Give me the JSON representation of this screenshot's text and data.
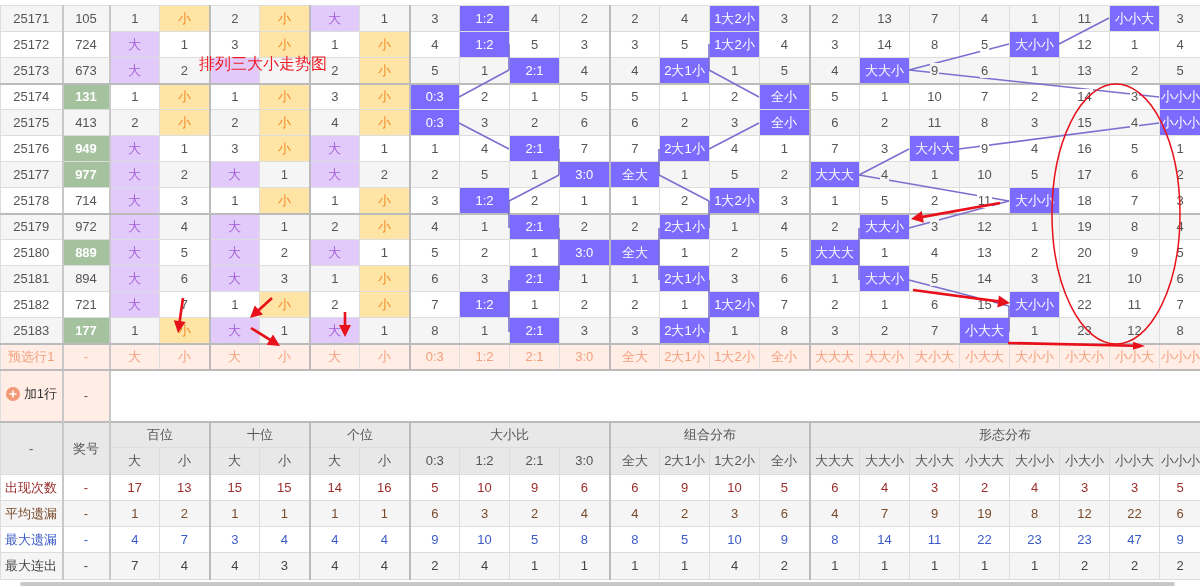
{
  "annotation_title": "排列三大小走势图",
  "header": {
    "corner": "-",
    "number_label": "奖号"
  },
  "groups": [
    {
      "label": "百位",
      "kind": "digit",
      "columns": [
        "大",
        "小"
      ]
    },
    {
      "label": "十位",
      "kind": "digit",
      "columns": [
        "大",
        "小"
      ]
    },
    {
      "label": "个位",
      "kind": "digit",
      "columns": [
        "大",
        "小"
      ]
    },
    {
      "label": "大小比",
      "kind": "pattern",
      "columns": [
        "0:3",
        "1:2",
        "2:1",
        "3:0"
      ]
    },
    {
      "label": "组合分布",
      "kind": "pattern",
      "columns": [
        "全大",
        "2大1小",
        "1大2小",
        "全小"
      ]
    },
    {
      "label": "形态分布",
      "kind": "pattern",
      "columns": [
        "大大大",
        "大大小",
        "大小大",
        "小大大",
        "大小小",
        "小大小",
        "小小大",
        "小小小"
      ]
    }
  ],
  "rows": [
    {
      "period": "25171",
      "number": "105",
      "highlighted": false,
      "cells": [
        {
          "text": "1",
          "hit": false
        },
        {
          "text": "小",
          "hit": true
        },
        {
          "text": "2",
          "hit": false
        },
        {
          "text": "小",
          "hit": true
        },
        {
          "text": "大",
          "hit": true
        },
        {
          "text": "1",
          "hit": false
        },
        {
          "text": "3",
          "hit": false
        },
        {
          "text": "1:2",
          "hit": true
        },
        {
          "text": "4",
          "hit": false
        },
        {
          "text": "2",
          "hit": false
        },
        {
          "text": "2",
          "hit": false
        },
        {
          "text": "4",
          "hit": false
        },
        {
          "text": "1大2小",
          "hit": true
        },
        {
          "text": "3",
          "hit": false
        },
        {
          "text": "2",
          "hit": false
        },
        {
          "text": "13",
          "hit": false
        },
        {
          "text": "7",
          "hit": false
        },
        {
          "text": "4",
          "hit": false
        },
        {
          "text": "1",
          "hit": false
        },
        {
          "text": "11",
          "hit": false
        },
        {
          "text": "小小大",
          "hit": true
        },
        {
          "text": "3",
          "hit": false
        }
      ]
    },
    {
      "period": "25172",
      "number": "724",
      "highlighted": false,
      "cells": [
        {
          "text": "大",
          "hit": true
        },
        {
          "text": "1",
          "hit": false
        },
        {
          "text": "3",
          "hit": false
        },
        {
          "text": "小",
          "hit": true
        },
        {
          "text": "1",
          "hit": false
        },
        {
          "text": "小",
          "hit": true
        },
        {
          "text": "4",
          "hit": false
        },
        {
          "text": "1:2",
          "hit": true
        },
        {
          "text": "5",
          "hit": false
        },
        {
          "text": "3",
          "hit": false
        },
        {
          "text": "3",
          "hit": false
        },
        {
          "text": "5",
          "hit": false
        },
        {
          "text": "1大2小",
          "hit": true
        },
        {
          "text": "4",
          "hit": false
        },
        {
          "text": "3",
          "hit": false
        },
        {
          "text": "14",
          "hit": false
        },
        {
          "text": "8",
          "hit": false
        },
        {
          "text": "5",
          "hit": false
        },
        {
          "text": "大小小",
          "hit": true
        },
        {
          "text": "12",
          "hit": false
        },
        {
          "text": "1",
          "hit": false
        },
        {
          "text": "4",
          "hit": false
        }
      ]
    },
    {
      "period": "25173",
      "number": "673",
      "highlighted": false,
      "cells": [
        {
          "text": "大",
          "hit": true
        },
        {
          "text": "2",
          "hit": false
        },
        {
          "hit": true
        },
        {
          "hit": false
        },
        {
          "text": "2",
          "hit": false
        },
        {
          "text": "小",
          "hit": true
        },
        {
          "text": "5",
          "hit": false
        },
        {
          "text": "1",
          "hit": false
        },
        {
          "text": "2:1",
          "hit": true
        },
        {
          "text": "4",
          "hit": false
        },
        {
          "text": "4",
          "hit": false
        },
        {
          "text": "2大1小",
          "hit": true
        },
        {
          "text": "1",
          "hit": false
        },
        {
          "text": "5",
          "hit": false
        },
        {
          "text": "4",
          "hit": false
        },
        {
          "text": "大大小",
          "hit": true
        },
        {
          "text": "9",
          "hit": false
        },
        {
          "text": "6",
          "hit": false
        },
        {
          "text": "1",
          "hit": false
        },
        {
          "text": "13",
          "hit": false
        },
        {
          "text": "2",
          "hit": false
        },
        {
          "text": "5",
          "hit": false
        }
      ]
    },
    {
      "period": "25174",
      "number": "131",
      "highlighted": true,
      "cells": [
        {
          "text": "1",
          "hit": false
        },
        {
          "text": "小",
          "hit": true
        },
        {
          "text": "1",
          "hit": false
        },
        {
          "text": "小",
          "hit": true
        },
        {
          "text": "3",
          "hit": false
        },
        {
          "text": "小",
          "hit": true
        },
        {
          "text": "0:3",
          "hit": true
        },
        {
          "text": "2",
          "hit": false
        },
        {
          "text": "1",
          "hit": false
        },
        {
          "text": "5",
          "hit": false
        },
        {
          "text": "5",
          "hit": false
        },
        {
          "text": "1",
          "hit": false
        },
        {
          "text": "2",
          "hit": false
        },
        {
          "text": "全小",
          "hit": true
        },
        {
          "text": "5",
          "hit": false
        },
        {
          "text": "1",
          "hit": false
        },
        {
          "text": "10",
          "hit": false
        },
        {
          "text": "7",
          "hit": false
        },
        {
          "text": "2",
          "hit": false
        },
        {
          "text": "14",
          "hit": false
        },
        {
          "text": "3",
          "hit": false
        },
        {
          "text": "小小小",
          "hit": true
        }
      ]
    },
    {
      "period": "25175",
      "number": "413",
      "highlighted": false,
      "cells": [
        {
          "text": "2",
          "hit": false
        },
        {
          "text": "小",
          "hit": true
        },
        {
          "text": "2",
          "hit": false
        },
        {
          "text": "小",
          "hit": true
        },
        {
          "text": "4",
          "hit": false
        },
        {
          "text": "小",
          "hit": true
        },
        {
          "text": "0:3",
          "hit": true
        },
        {
          "text": "3",
          "hit": false
        },
        {
          "text": "2",
          "hit": false
        },
        {
          "text": "6",
          "hit": false
        },
        {
          "text": "6",
          "hit": false
        },
        {
          "text": "2",
          "hit": false
        },
        {
          "text": "3",
          "hit": false
        },
        {
          "text": "全小",
          "hit": true
        },
        {
          "text": "6",
          "hit": false
        },
        {
          "text": "2",
          "hit": false
        },
        {
          "text": "11",
          "hit": false
        },
        {
          "text": "8",
          "hit": false
        },
        {
          "text": "3",
          "hit": false
        },
        {
          "text": "15",
          "hit": false
        },
        {
          "text": "4",
          "hit": false
        },
        {
          "text": "小小小",
          "hit": true
        }
      ]
    },
    {
      "period": "25176",
      "number": "949",
      "highlighted": true,
      "cells": [
        {
          "text": "大",
          "hit": true
        },
        {
          "text": "1",
          "hit": false
        },
        {
          "text": "3",
          "hit": false
        },
        {
          "text": "小",
          "hit": true
        },
        {
          "text": "大",
          "hit": true
        },
        {
          "text": "1",
          "hit": false
        },
        {
          "text": "1",
          "hit": false
        },
        {
          "text": "4",
          "hit": false
        },
        {
          "text": "2:1",
          "hit": true
        },
        {
          "text": "7",
          "hit": false
        },
        {
          "text": "7",
          "hit": false
        },
        {
          "text": "2大1小",
          "hit": true
        },
        {
          "text": "4",
          "hit": false
        },
        {
          "text": "1",
          "hit": false
        },
        {
          "text": "7",
          "hit": false
        },
        {
          "text": "3",
          "hit": false
        },
        {
          "text": "大小大",
          "hit": true
        },
        {
          "text": "9",
          "hit": false
        },
        {
          "text": "4",
          "hit": false
        },
        {
          "text": "16",
          "hit": false
        },
        {
          "text": "5",
          "hit": false
        },
        {
          "text": "1",
          "hit": false
        }
      ]
    },
    {
      "period": "25177",
      "number": "977",
      "highlighted": true,
      "cells": [
        {
          "text": "大",
          "hit": true
        },
        {
          "text": "2",
          "hit": false
        },
        {
          "text": "大",
          "hit": true
        },
        {
          "text": "1",
          "hit": false
        },
        {
          "text": "大",
          "hit": true
        },
        {
          "text": "2",
          "hit": false
        },
        {
          "text": "2",
          "hit": false
        },
        {
          "text": "5",
          "hit": false
        },
        {
          "text": "1",
          "hit": false
        },
        {
          "text": "3:0",
          "hit": true
        },
        {
          "text": "全大",
          "hit": true
        },
        {
          "text": "1",
          "hit": false
        },
        {
          "text": "5",
          "hit": false
        },
        {
          "text": "2",
          "hit": false
        },
        {
          "text": "大大大",
          "hit": true
        },
        {
          "text": "4",
          "hit": false
        },
        {
          "text": "1",
          "hit": false
        },
        {
          "text": "10",
          "hit": false
        },
        {
          "text": "5",
          "hit": false
        },
        {
          "text": "17",
          "hit": false
        },
        {
          "text": "6",
          "hit": false
        },
        {
          "text": "2",
          "hit": false
        }
      ]
    },
    {
      "period": "25178",
      "number": "714",
      "highlighted": false,
      "cells": [
        {
          "text": "大",
          "hit": true
        },
        {
          "text": "3",
          "hit": false
        },
        {
          "text": "1",
          "hit": false
        },
        {
          "text": "小",
          "hit": true
        },
        {
          "text": "1",
          "hit": false
        },
        {
          "text": "小",
          "hit": true
        },
        {
          "text": "3",
          "hit": false
        },
        {
          "text": "1:2",
          "hit": true
        },
        {
          "text": "2",
          "hit": false
        },
        {
          "text": "1",
          "hit": false
        },
        {
          "text": "1",
          "hit": false
        },
        {
          "text": "2",
          "hit": false
        },
        {
          "text": "1大2小",
          "hit": true
        },
        {
          "text": "3",
          "hit": false
        },
        {
          "text": "1",
          "hit": false
        },
        {
          "text": "5",
          "hit": false
        },
        {
          "text": "2",
          "hit": false
        },
        {
          "text": "11",
          "hit": false
        },
        {
          "text": "大小小",
          "hit": true
        },
        {
          "text": "18",
          "hit": false
        },
        {
          "text": "7",
          "hit": false
        },
        {
          "text": "3",
          "hit": false
        }
      ]
    },
    {
      "period": "25179",
      "number": "972",
      "highlighted": false,
      "cells": [
        {
          "text": "大",
          "hit": true
        },
        {
          "text": "4",
          "hit": false
        },
        {
          "text": "大",
          "hit": true
        },
        {
          "text": "1",
          "hit": false
        },
        {
          "text": "2",
          "hit": false
        },
        {
          "text": "小",
          "hit": true
        },
        {
          "text": "4",
          "hit": false
        },
        {
          "text": "1",
          "hit": false
        },
        {
          "text": "2:1",
          "hit": true
        },
        {
          "text": "2",
          "hit": false
        },
        {
          "text": "2",
          "hit": false
        },
        {
          "text": "2大1小",
          "hit": true
        },
        {
          "text": "1",
          "hit": false
        },
        {
          "text": "4",
          "hit": false
        },
        {
          "text": "2",
          "hit": false
        },
        {
          "text": "大大小",
          "hit": true
        },
        {
          "text": "3",
          "hit": false
        },
        {
          "text": "12",
          "hit": false
        },
        {
          "text": "1",
          "hit": false
        },
        {
          "text": "19",
          "hit": false
        },
        {
          "text": "8",
          "hit": false
        },
        {
          "text": "4",
          "hit": false
        }
      ]
    },
    {
      "period": "25180",
      "number": "889",
      "highlighted": true,
      "cells": [
        {
          "text": "大",
          "hit": true
        },
        {
          "text": "5",
          "hit": false
        },
        {
          "text": "大",
          "hit": true
        },
        {
          "text": "2",
          "hit": false
        },
        {
          "text": "大",
          "hit": true
        },
        {
          "text": "1",
          "hit": false
        },
        {
          "text": "5",
          "hit": false
        },
        {
          "text": "2",
          "hit": false
        },
        {
          "text": "1",
          "hit": false
        },
        {
          "text": "3:0",
          "hit": true
        },
        {
          "text": "全大",
          "hit": true
        },
        {
          "text": "1",
          "hit": false
        },
        {
          "text": "2",
          "hit": false
        },
        {
          "text": "5",
          "hit": false
        },
        {
          "text": "大大大",
          "hit": true
        },
        {
          "text": "1",
          "hit": false
        },
        {
          "text": "4",
          "hit": false
        },
        {
          "text": "13",
          "hit": false
        },
        {
          "text": "2",
          "hit": false
        },
        {
          "text": "20",
          "hit": false
        },
        {
          "text": "9",
          "hit": false
        },
        {
          "text": "5",
          "hit": false
        }
      ]
    },
    {
      "period": "25181",
      "number": "894",
      "highlighted": false,
      "cells": [
        {
          "text": "大",
          "hit": true
        },
        {
          "text": "6",
          "hit": false
        },
        {
          "text": "大",
          "hit": true
        },
        {
          "text": "3",
          "hit": false
        },
        {
          "text": "1",
          "hit": false
        },
        {
          "text": "小",
          "hit": true
        },
        {
          "text": "6",
          "hit": false
        },
        {
          "text": "3",
          "hit": false
        },
        {
          "text": "2:1",
          "hit": true
        },
        {
          "text": "1",
          "hit": false
        },
        {
          "text": "1",
          "hit": false
        },
        {
          "text": "2大1小",
          "hit": true
        },
        {
          "text": "3",
          "hit": false
        },
        {
          "text": "6",
          "hit": false
        },
        {
          "text": "1",
          "hit": false
        },
        {
          "text": "大大小",
          "hit": true
        },
        {
          "text": "5",
          "hit": false
        },
        {
          "text": "14",
          "hit": false
        },
        {
          "text": "3",
          "hit": false
        },
        {
          "text": "21",
          "hit": false
        },
        {
          "text": "10",
          "hit": false
        },
        {
          "text": "6",
          "hit": false
        }
      ]
    },
    {
      "period": "25182",
      "number": "721",
      "highlighted": false,
      "cells": [
        {
          "text": "大",
          "hit": true
        },
        {
          "text": "7",
          "hit": false
        },
        {
          "text": "1",
          "hit": false
        },
        {
          "text": "小",
          "hit": true
        },
        {
          "text": "2",
          "hit": false
        },
        {
          "text": "小",
          "hit": true
        },
        {
          "text": "7",
          "hit": false
        },
        {
          "text": "1:2",
          "hit": true
        },
        {
          "text": "1",
          "hit": false
        },
        {
          "text": "2",
          "hit": false
        },
        {
          "text": "2",
          "hit": false
        },
        {
          "text": "1",
          "hit": false
        },
        {
          "text": "1大2小",
          "hit": true
        },
        {
          "text": "7",
          "hit": false
        },
        {
          "text": "2",
          "hit": false
        },
        {
          "text": "1",
          "hit": false
        },
        {
          "text": "6",
          "hit": false
        },
        {
          "text": "15",
          "hit": false
        },
        {
          "text": "大小小",
          "hit": true
        },
        {
          "text": "22",
          "hit": false
        },
        {
          "text": "11",
          "hit": false
        },
        {
          "text": "7",
          "hit": false
        }
      ]
    },
    {
      "period": "25183",
      "number": "177",
      "highlighted": true,
      "cells": [
        {
          "text": "1",
          "hit": false
        },
        {
          "text": "小",
          "hit": true
        },
        {
          "text": "大",
          "hit": true
        },
        {
          "text": "1",
          "hit": false
        },
        {
          "text": "大",
          "hit": true
        },
        {
          "text": "1",
          "hit": false
        },
        {
          "text": "8",
          "hit": false
        },
        {
          "text": "1",
          "hit": false
        },
        {
          "text": "2:1",
          "hit": true
        },
        {
          "text": "3",
          "hit": false
        },
        {
          "text": "3",
          "hit": false
        },
        {
          "text": "2大1小",
          "hit": true
        },
        {
          "text": "1",
          "hit": false
        },
        {
          "text": "8",
          "hit": false
        },
        {
          "text": "3",
          "hit": false
        },
        {
          "text": "2",
          "hit": false
        },
        {
          "text": "7",
          "hit": false
        },
        {
          "text": "小大大",
          "hit": true
        },
        {
          "text": "1",
          "hit": false
        },
        {
          "text": "23",
          "hit": false
        },
        {
          "text": "12",
          "hit": false
        },
        {
          "text": "8",
          "hit": false
        }
      ]
    }
  ],
  "preselect": {
    "label": "预选行1",
    "number": "-",
    "cells": [
      "大",
      "小",
      "大",
      "小",
      "大",
      "小",
      "0:3",
      "1:2",
      "2:1",
      "3:0",
      "全大",
      "2大1小",
      "1大2小",
      "全小",
      "大大大",
      "大大小",
      "大小大",
      "小大大",
      "大小小",
      "小大小",
      "小小大",
      "小小小"
    ]
  },
  "add_row": {
    "label": "加1行",
    "number": "-"
  },
  "stats": [
    {
      "kind": "count",
      "label": "出现次数",
      "number": "-",
      "values": [
        "17",
        "13",
        "15",
        "15",
        "14",
        "16",
        "5",
        "10",
        "9",
        "6",
        "6",
        "9",
        "10",
        "5",
        "6",
        "4",
        "3",
        "2",
        "4",
        "3",
        "3",
        "5"
      ]
    },
    {
      "kind": "avg_miss",
      "label": "平均遗漏",
      "number": "-",
      "values": [
        "1",
        "2",
        "1",
        "1",
        "1",
        "1",
        "6",
        "3",
        "2",
        "4",
        "4",
        "2",
        "3",
        "6",
        "4",
        "7",
        "9",
        "19",
        "8",
        "12",
        "22",
        "6"
      ]
    },
    {
      "kind": "max_miss",
      "label": "最大遗漏",
      "number": "-",
      "values": [
        "4",
        "7",
        "3",
        "4",
        "4",
        "4",
        "9",
        "10",
        "5",
        "8",
        "8",
        "5",
        "10",
        "9",
        "8",
        "14",
        "11",
        "22",
        "23",
        "23",
        "47",
        "9"
      ]
    },
    {
      "kind": "max_streak",
      "label": "最大连出",
      "number": "-",
      "values": [
        "7",
        "4",
        "4",
        "3",
        "4",
        "4",
        "2",
        "4",
        "1",
        "1",
        "1",
        "1",
        "4",
        "2",
        "1",
        "1",
        "1",
        "1",
        "1",
        "2",
        "2",
        "2"
      ]
    }
  ]
}
